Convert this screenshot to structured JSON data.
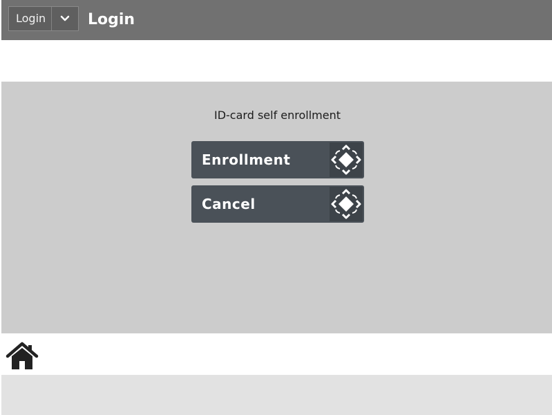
{
  "header": {
    "mode_dropdown": {
      "selected": "Login",
      "icon": "chevron-down-icon"
    },
    "title": "Login"
  },
  "dialog": {
    "prompt": "ID-card self enrollment",
    "buttons": [
      {
        "label": "Enrollment",
        "icon": "rotate-diamond-icon"
      },
      {
        "label": "Cancel",
        "icon": "rotate-diamond-icon"
      }
    ]
  },
  "bottom_nav": {
    "home_icon": "home-icon"
  },
  "colors": {
    "header_bg": "#717171",
    "panel_bg": "#cccccc",
    "button_bg": "#4a5158",
    "footer_bg": "#e2e2e2"
  }
}
